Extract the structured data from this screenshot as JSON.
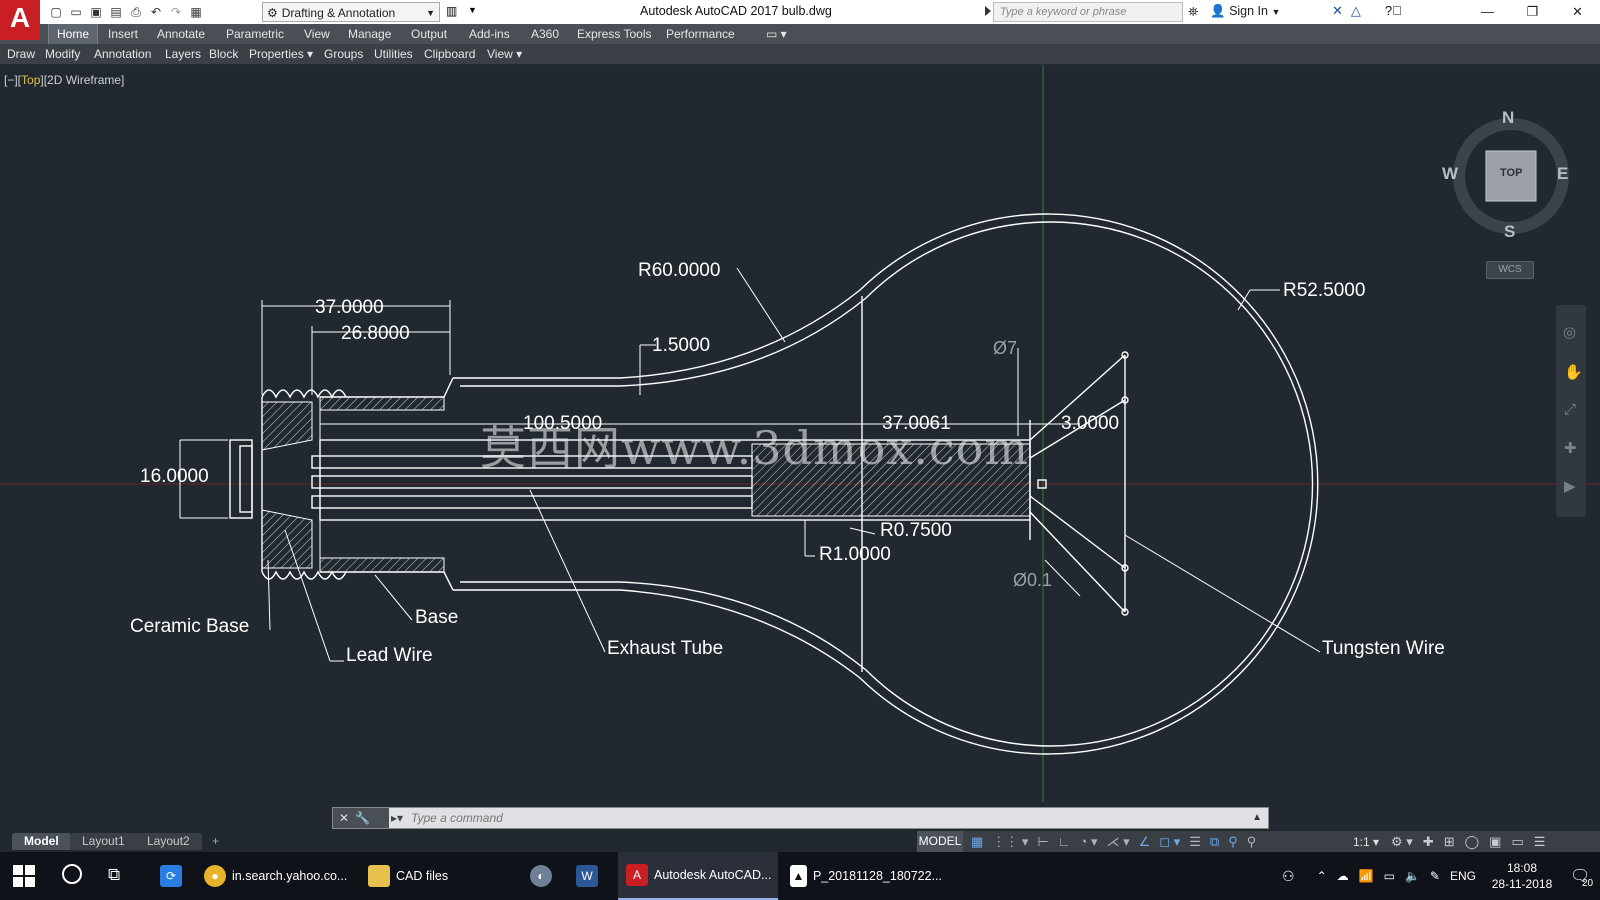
{
  "app": {
    "logo_letter": "A",
    "window_title": "Autodesk AutoCAD 2017    bulb.dwg",
    "workspace": "Drafting & Annotation",
    "search_placeholder": "Type a keyword or phrase",
    "sign_in": "Sign In"
  },
  "ribbon": {
    "tabs": [
      "Home",
      "Insert",
      "Annotate",
      "Parametric",
      "View",
      "Manage",
      "Output",
      "Add-ins",
      "A360",
      "Express Tools",
      "Performance"
    ],
    "active_tab": "Home",
    "panels": [
      "Draw",
      "Modify",
      "Annotation",
      "Layers",
      "Block",
      "Properties ▾",
      "Groups",
      "Utilities",
      "Clipboard",
      "View ▾"
    ]
  },
  "viewport": {
    "label_prefix": "[−][",
    "label_view": "Top",
    "label_suffix": "][2D Wireframe]",
    "watermark": "莫西网www.3dmox.com"
  },
  "drawing": {
    "dimensions": {
      "d37": "37.0000",
      "d26_8": "26.8000",
      "d16": "16.0000",
      "d1_5": "1.5000",
      "r60": "R60.0000",
      "d100_5": "100.5000",
      "d37_0061": "37.0061",
      "d3": "3.0000",
      "d_dia7": "Ø7",
      "r52_5": "R52.5000",
      "r0_75": "R0.7500",
      "r1": "R1.0000",
      "d_dia01": "Ø0.1"
    },
    "labels": {
      "ceramic_base": "Ceramic Base",
      "lead_wire": "Lead Wire",
      "base": "Base",
      "exhaust_tube": "Exhaust Tube",
      "tungsten_wire": "Tungsten Wire"
    }
  },
  "viewcube": {
    "north": "N",
    "south": "S",
    "east": "E",
    "west": "W",
    "face": "TOP",
    "wcs": "WCS"
  },
  "command_line": {
    "placeholder": "Type a command"
  },
  "layout_tabs": [
    "Model",
    "Layout1",
    "Layout2",
    "+"
  ],
  "status_bar": {
    "model": "MODEL",
    "scale": "1:1 ▾"
  },
  "taskbar": {
    "items": [
      {
        "label": "in.search.yahoo.co...",
        "icon": "chrome-icon"
      },
      {
        "label": "CAD files",
        "icon": "folder-icon"
      },
      {
        "label": "",
        "icon": "paint-icon"
      },
      {
        "label": "",
        "icon": "word-icon"
      },
      {
        "label": "Autodesk AutoCAD...",
        "icon": "autocad-icon"
      },
      {
        "label": "P_20181128_180722...",
        "icon": "photo-icon"
      }
    ],
    "lang": "ENG",
    "time": "18:08",
    "date": "28-11-2018",
    "notification_count": "20"
  },
  "colors": {
    "viewport_bg": "#212830",
    "drawing_line": "#ffffff",
    "ribbon_bg": "#4a4f56",
    "autocad_red": "#c81e24"
  }
}
